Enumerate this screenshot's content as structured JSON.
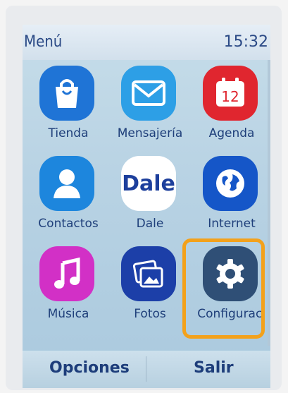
{
  "status_bar": {
    "title": "Menú",
    "time": "15:32"
  },
  "apps": [
    {
      "label": "Tienda",
      "icon": "shopping-bag-icon",
      "color": "#1f74d6"
    },
    {
      "label": "Mensajería",
      "icon": "envelope-icon",
      "color": "#2d9fe6"
    },
    {
      "label": "Agenda",
      "icon": "calendar-icon",
      "color": "#e0262f",
      "icon_text": "12"
    },
    {
      "label": "Contactos",
      "icon": "person-icon",
      "color": "#1d86dd"
    },
    {
      "label": "Dale",
      "icon": "dale-logo-icon",
      "color": "#ffffff",
      "icon_text": "Dale"
    },
    {
      "label": "Internet",
      "icon": "globe-icon",
      "color": "#1556c8"
    },
    {
      "label": "Música",
      "icon": "music-note-icon",
      "color": "#d230c6"
    },
    {
      "label": "Fotos",
      "icon": "photos-icon",
      "color": "#1c3fa8"
    },
    {
      "label": "Configurac.",
      "icon": "gear-icon",
      "color": "#2f4f76"
    }
  ],
  "softkeys": {
    "left": "Opciones",
    "right": "Salir"
  },
  "highlight_color": "#f3a11b"
}
